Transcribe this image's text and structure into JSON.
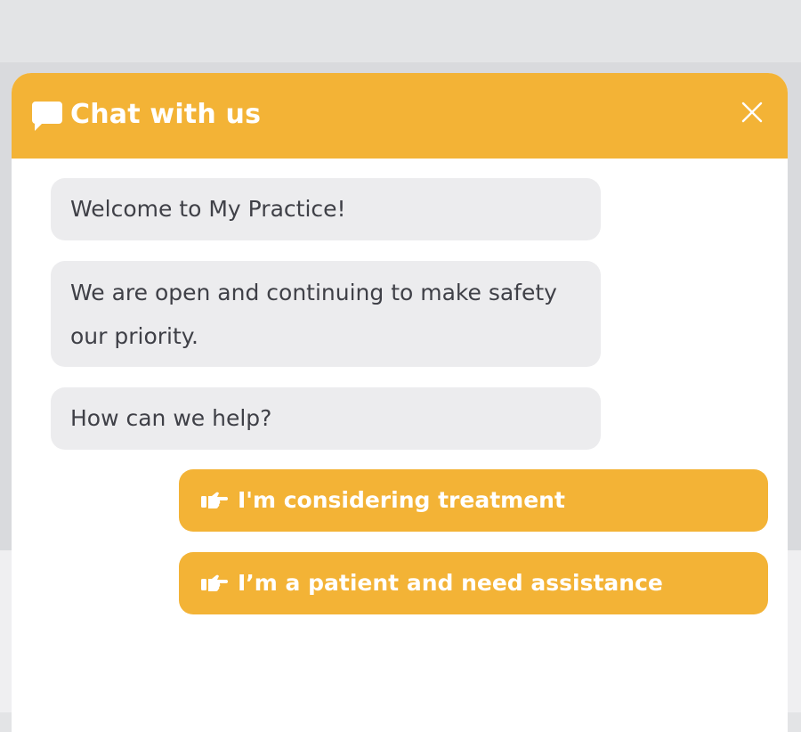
{
  "chat": {
    "title": "Chat with us",
    "messages": [
      "Welcome to My Practice!",
      "We are open and continuing to make safety our priority.",
      "How can we help?"
    ],
    "options": [
      "I'm considering treatment",
      "I’m a patient and need assistance"
    ]
  },
  "icons": {
    "chat_bubble": "chat-bubble-icon",
    "close": "close-icon",
    "pointing_hand": "pointing-hand-icon"
  },
  "colors": {
    "accent": "#f3b336",
    "bubble": "#ececee",
    "text": "#3f4047",
    "background": "#e3e4e6"
  }
}
